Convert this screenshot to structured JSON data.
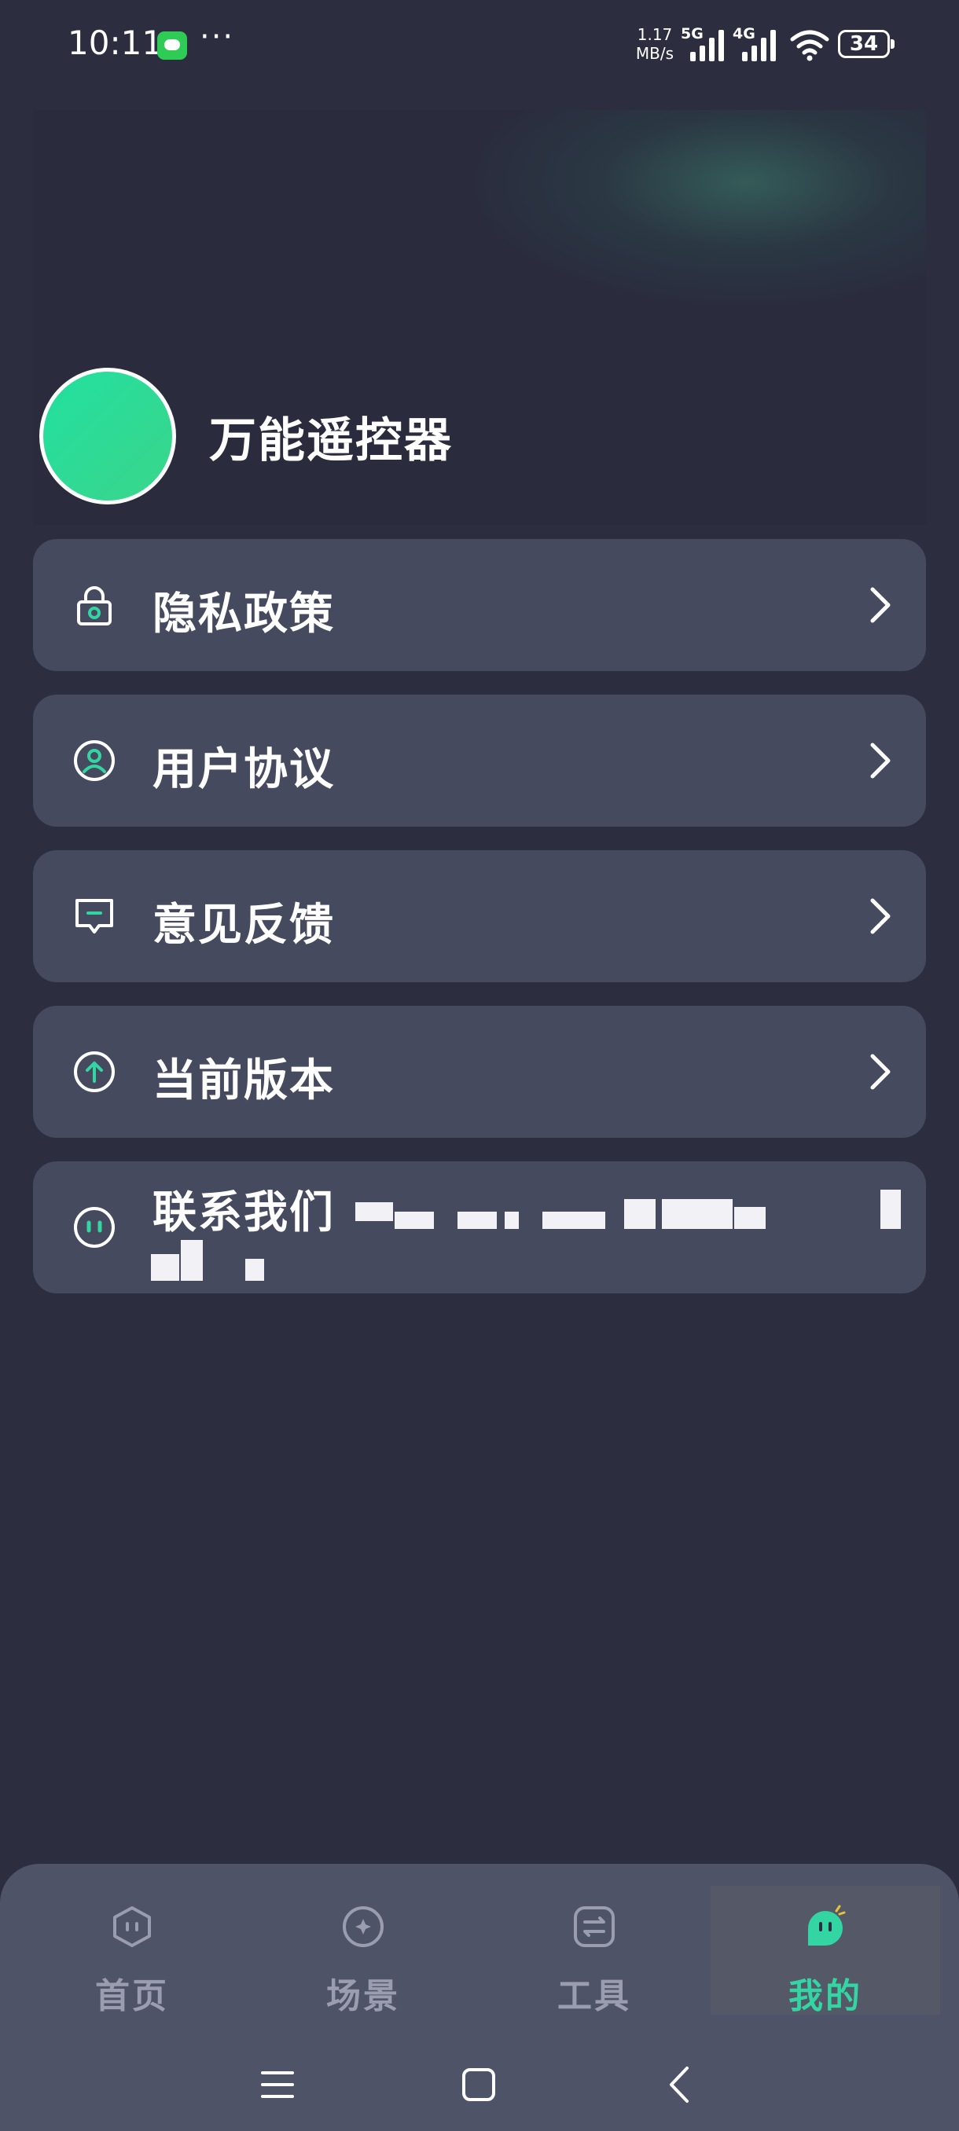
{
  "status_bar": {
    "time": "10:11",
    "dots": "···",
    "net_speed_value": "1.17",
    "net_speed_unit": "MB/s",
    "sim1": "5G",
    "sim2": "4G",
    "battery": "34"
  },
  "profile": {
    "app_name": "万能遥控器"
  },
  "menu": {
    "items": [
      {
        "label": "隐私政策",
        "icon": "lock-icon"
      },
      {
        "label": "用户协议",
        "icon": "user-icon"
      },
      {
        "label": "意见反馈",
        "icon": "feedback-icon"
      },
      {
        "label": "当前版本",
        "icon": "upload-icon"
      }
    ],
    "contact": {
      "label": "联系我们",
      "icon": "robot-icon"
    }
  },
  "bottom_nav": {
    "items": [
      {
        "label": "首页",
        "icon": "home-icon"
      },
      {
        "label": "场景",
        "icon": "scene-icon"
      },
      {
        "label": "工具",
        "icon": "tools-icon"
      },
      {
        "label": "我的",
        "icon": "profile-icon",
        "active": true
      }
    ]
  },
  "colors": {
    "background": "#2c2e40",
    "card": "#464a5e",
    "accent": "#33d6a3",
    "nav_bg": "#4f5367"
  }
}
